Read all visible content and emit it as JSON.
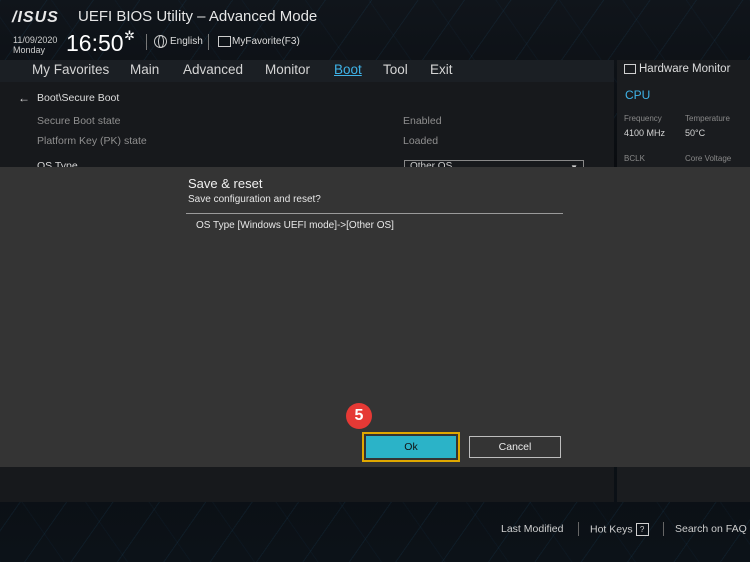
{
  "header": {
    "logo": "/ISUS",
    "title": "UEFI BIOS Utility – Advanced Mode",
    "date": "11/09/2020",
    "day": "Monday",
    "time": "16:50",
    "language": "English",
    "favorite": "MyFavorite(F3)"
  },
  "menu": {
    "items": [
      "My Favorites",
      "Main",
      "Advanced",
      "Monitor",
      "Boot",
      "Tool",
      "Exit"
    ],
    "active": "Boot"
  },
  "main": {
    "breadcrumb": "Boot\\Secure Boot",
    "rows": [
      {
        "label": "Secure Boot state",
        "value": "Enabled"
      },
      {
        "label": "Platform Key (PK) state",
        "value": "Loaded"
      }
    ],
    "os_type_label": "OS Type",
    "os_type_value": "Other OS"
  },
  "hardware_monitor": {
    "title": "Hardware Monitor",
    "section": "CPU",
    "frequency_label": "Frequency",
    "frequency_value": "4100 MHz",
    "temperature_label": "Temperature",
    "temperature_value": "50°C",
    "bclk_label": "BCLK",
    "core_voltage_label": "Core Voltage"
  },
  "dialog": {
    "title": "Save & reset",
    "subtitle": "Save configuration and reset?",
    "change": "OS Type [Windows UEFI mode]->[Other OS]",
    "ok_label": "Ok",
    "cancel_label": "Cancel",
    "step_number": "5"
  },
  "footer": {
    "last_modified": "Last Modified",
    "hot_keys": "Hot Keys",
    "hot_keys_key": "?",
    "search_faq": "Search on FAQ"
  },
  "colors": {
    "accent": "#3fb3e8",
    "ok_button": "#2bb3c8",
    "highlight_outline": "#e0a800",
    "step_badge": "#e53935"
  }
}
